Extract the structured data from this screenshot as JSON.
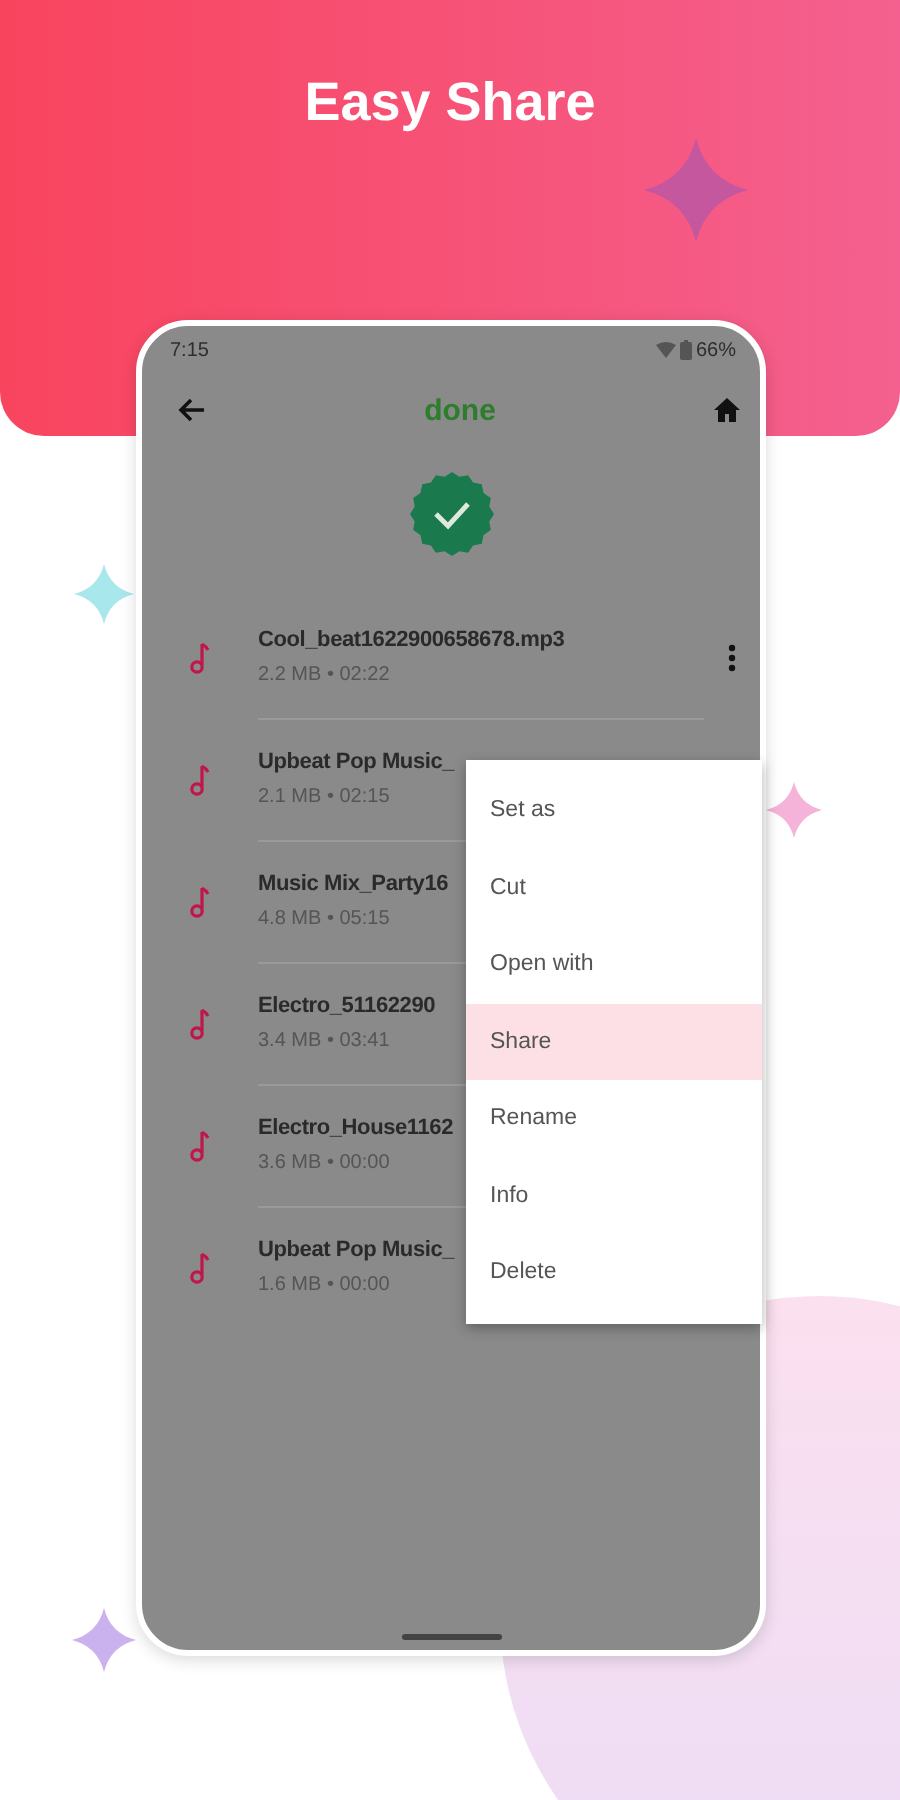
{
  "headline": "Easy Share",
  "status_bar": {
    "time": "7:15",
    "battery": "66%"
  },
  "app_bar": {
    "title": "done"
  },
  "files": [
    {
      "name": "Cool_beat1622900658678.mp3",
      "meta": "2.2 MB • 02:22"
    },
    {
      "name": "Upbeat Pop Music_",
      "meta": "2.1 MB • 02:15"
    },
    {
      "name": "Music Mix_Party16",
      "meta": "4.8 MB • 05:15"
    },
    {
      "name": "Electro_51162290",
      "meta": "3.4 MB • 03:41"
    },
    {
      "name": "Electro_House1162",
      "meta": "3.6 MB • 00:00"
    },
    {
      "name": "Upbeat Pop Music_",
      "meta": "1.6 MB • 00:00"
    }
  ],
  "menu": [
    {
      "label": "Set as",
      "selected": false
    },
    {
      "label": "Cut",
      "selected": false
    },
    {
      "label": "Open with",
      "selected": false
    },
    {
      "label": "Share",
      "selected": true
    },
    {
      "label": "Rename",
      "selected": false
    },
    {
      "label": "Info",
      "selected": false
    },
    {
      "label": "Delete",
      "selected": false
    }
  ]
}
